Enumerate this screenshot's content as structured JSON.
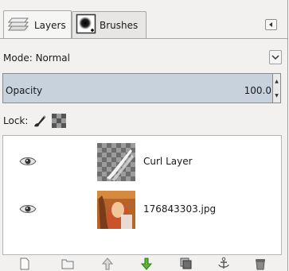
{
  "tabs": [
    {
      "label": "Layers",
      "icon": "layers-icon",
      "active": true
    },
    {
      "label": "Brushes",
      "icon": "brush-icon",
      "active": false
    }
  ],
  "mode": {
    "label": "Mode:",
    "value": "Normal"
  },
  "opacity": {
    "label": "Opacity",
    "value": "100.0"
  },
  "lock": {
    "label": "Lock:",
    "icons": [
      "lock-pixels-icon",
      "lock-alpha-icon"
    ]
  },
  "layers": [
    {
      "name": "Curl Layer",
      "visible": true
    },
    {
      "name": "176843303.jpg",
      "visible": true
    }
  ],
  "toolbar": [
    "new-layer-icon",
    "new-layer-group-icon",
    "raise-layer-icon",
    "lower-layer-icon",
    "duplicate-layer-icon",
    "anchor-layer-icon",
    "delete-layer-icon"
  ],
  "colors": {
    "opacity_fill": "#c7d2dd",
    "panel_bg": "#f2f1f0",
    "list_bg": "#ffffff"
  }
}
